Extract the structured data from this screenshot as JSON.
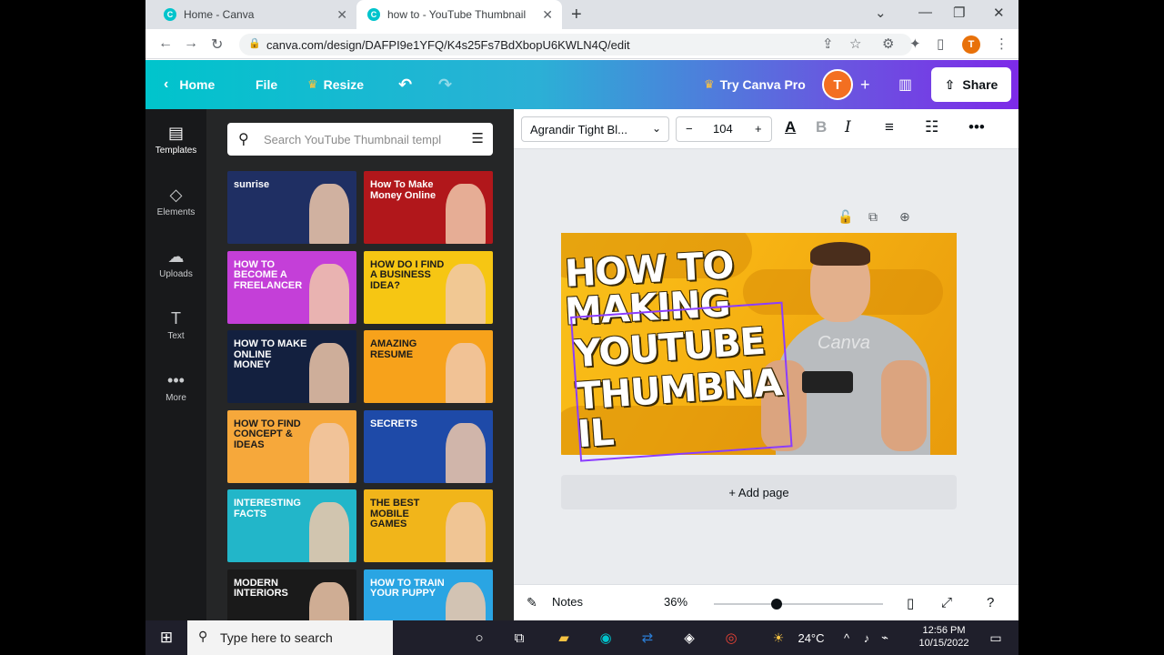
{
  "browser": {
    "tabs": [
      {
        "title": "Home - Canva"
      },
      {
        "title": "how to - YouTube Thumbnail"
      }
    ],
    "url": "canva.com/design/DAFPI9e1YFQ/K4s25Fs7BdXbopU6KWLN4Q/edit",
    "profile_initial": "T"
  },
  "canva_header": {
    "home": "Home",
    "file": "File",
    "resize": "Resize",
    "try_pro": "Try Canva Pro",
    "avatar_initial": "T",
    "share": "Share"
  },
  "rail": [
    {
      "label": "Templates"
    },
    {
      "label": "Elements"
    },
    {
      "label": "Uploads"
    },
    {
      "label": "Text"
    },
    {
      "label": "More"
    }
  ],
  "templates_panel": {
    "search_placeholder": "Search YouTube Thumbnail templ",
    "thumbnails": [
      {
        "text": "sunrise",
        "bg": "#1f2f63"
      },
      {
        "text": "How To Make Money Online",
        "bg": "#b1171b"
      },
      {
        "text": "HOW TO BECOME A FREELANCER",
        "bg": "#c43fd8"
      },
      {
        "text": "HOW DO I FIND A BUSINESS IDEA?",
        "bg": "#f6c613"
      },
      {
        "text": "HOW TO MAKE ONLINE MONEY",
        "bg": "#13203f"
      },
      {
        "text": "AMAZING RESUME",
        "bg": "#f7a21b"
      },
      {
        "text": "HOW TO FIND CONCEPT & IDEAS",
        "bg": "#f6a83b"
      },
      {
        "text": "SECRETS",
        "bg": "#1e4aa8"
      },
      {
        "text": "INTERESTING FACTS",
        "bg": "#22b6c9"
      },
      {
        "text": "THE BEST MOBILE GAMES",
        "bg": "#f1b51a"
      },
      {
        "text": "MODERN INTERIORS",
        "bg": "#1a1a1a"
      },
      {
        "text": "HOW TO TRAIN YOUR PUPPY",
        "bg": "#2aa5e3"
      }
    ]
  },
  "toolbar": {
    "font": "Agrandir Tight Bl...",
    "size": "104",
    "minus": "−",
    "plus": "+"
  },
  "canvas": {
    "lines": [
      "HOW TO",
      "MAKING",
      "YOUTUBE",
      "THUMBNA",
      "IL"
    ],
    "watermark": "Canva",
    "add_page": "+ Add page"
  },
  "bottombar": {
    "notes": "Notes",
    "zoom": "36%",
    "zoom_fraction": 0.36
  },
  "taskbar": {
    "search_placeholder": "Type here to search",
    "weather": "24°C",
    "time": "12:56 PM",
    "date": "10/15/2022"
  }
}
